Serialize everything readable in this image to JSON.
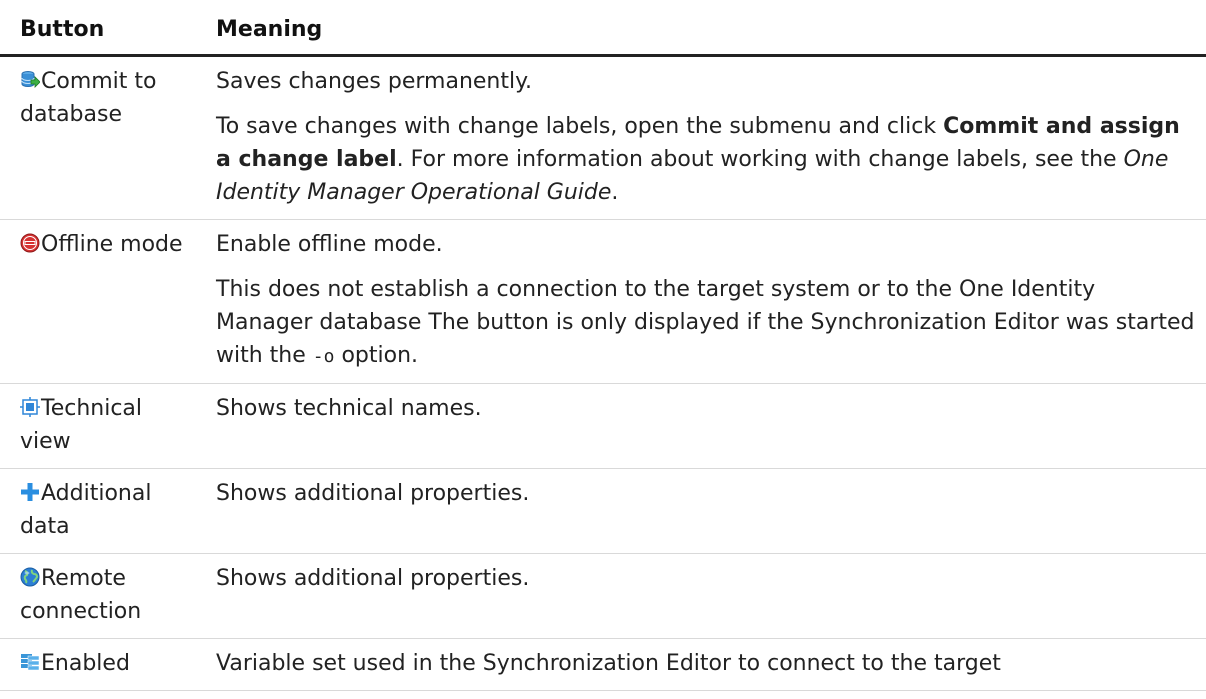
{
  "header": {
    "col_button": "Button",
    "col_meaning": "Meaning"
  },
  "rows": [
    {
      "icon": "commit-database-icon",
      "label": "Commit to database",
      "p1": "Saves changes permanently.",
      "p2": {
        "a": "To save changes with change labels, open the submenu and click ",
        "b": "Commit and assign a change label",
        "c": ". For more information about working with change labels, see the ",
        "d": "One Identity Manager Operational Guide",
        "e": "."
      }
    },
    {
      "icon": "stop-icon",
      "label": "Offline mode",
      "p1": "Enable offline mode.",
      "p2": {
        "a": "This does not establish a connection to the target system or to the One Identity Manager database The button is only displayed if the Synchron­ization Editor was started with the ",
        "code": "-o",
        "b": " option."
      }
    },
    {
      "icon": "technical-view-icon",
      "label": "Technical view",
      "p1": "Shows technical names."
    },
    {
      "icon": "plus-icon",
      "label": "Additional data",
      "p1": "Shows additional properties."
    },
    {
      "icon": "globe-icon",
      "label": "Remote connection",
      "p1": "Shows additional properties."
    },
    {
      "icon": "variable-set-icon",
      "label": "Enabled",
      "p1": "Variable set used in the Synchronization Editor to connect to the target"
    }
  ],
  "colors": {
    "commit": "#3a8fd6",
    "stop": "#d63232",
    "technical": "#2f86d8",
    "plus": "#2a8ee0",
    "globe": "#2b7fd4",
    "variable": "#3a96d8"
  }
}
